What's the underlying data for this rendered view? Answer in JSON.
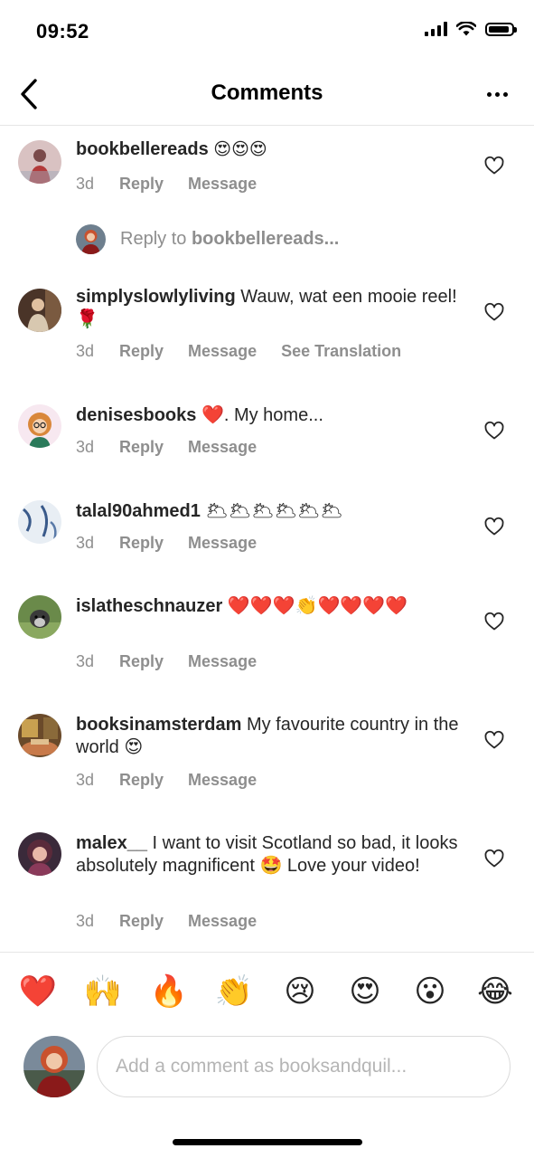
{
  "status_bar": {
    "time": "09:52",
    "battery_level": 0.9
  },
  "header": {
    "title": "Comments",
    "back_icon": "chevron-left-icon",
    "more_icon": "more-horizontal-icon"
  },
  "comments": [
    {
      "username": "bookbellereads",
      "text": "😍😍😍",
      "time": "3d",
      "reply": "Reply",
      "message": "Message",
      "avatar_color": "#c9a6a6"
    },
    {
      "username": "simplyslowlyliving",
      "text": "Wauw, wat een mooie reel! 🌹",
      "time": "3d",
      "reply": "Reply",
      "message": "Message",
      "translate": "See Translation",
      "avatar_color": "#6b4a3a"
    },
    {
      "username": "denisesbooks",
      "text": "❤️. My home...",
      "time": "3d",
      "reply": "Reply",
      "message": "Message",
      "avatar_color": "#e7a36a"
    },
    {
      "username": "talal90ahmed1",
      "text": "🌥🌥🌥🌥🌥🌥",
      "time": "3d",
      "reply": "Reply",
      "message": "Message",
      "avatar_color": "#b9c9d9"
    },
    {
      "username": "islatheschnauzer",
      "text": "❤️❤️❤️👏❤️❤️❤️❤️",
      "time": "3d",
      "reply": "Reply",
      "message": "Message",
      "avatar_color": "#5b7a4a"
    },
    {
      "username": "booksinamsterdam",
      "text": "My favourite country in the world 😍",
      "time": "3d",
      "reply": "Reply",
      "message": "Message",
      "avatar_color": "#a0643a"
    },
    {
      "username": "malex__",
      "text": "I want to visit Scotland so bad, it looks absolutely magnificent 🤩 Love your video!",
      "time": "3d",
      "reply": "Reply",
      "message": "Message",
      "avatar_color": "#7a3a4a"
    }
  ],
  "reply_prompt": {
    "prefix": "Reply to ",
    "username": "bookbellereads..."
  },
  "quick_reactions": [
    "❤️",
    "🙌",
    "🔥",
    "👏",
    "😢",
    "😍",
    "😮",
    "😂"
  ],
  "composer": {
    "placeholder": "Add a comment as booksandquil..."
  },
  "colors": {
    "text": "#262626",
    "secondary": "#8e8e8e",
    "divider": "#e6e6e6",
    "input_border": "#dbdbdb"
  }
}
